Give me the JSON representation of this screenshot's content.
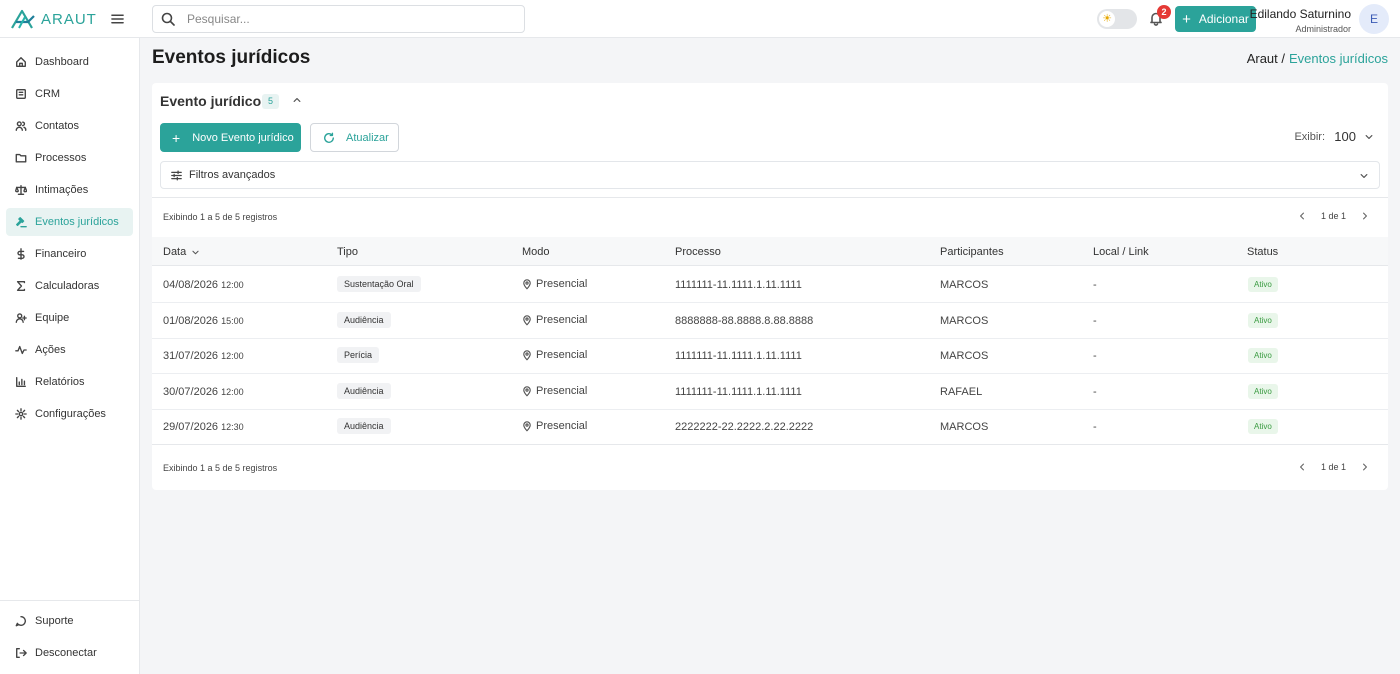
{
  "app": {
    "logo_text": "ARAUT"
  },
  "topbar": {
    "search_placeholder": "Pesquisar...",
    "notifications_count": "2",
    "add_label": "Adicionar",
    "user_name": "Edilando Saturnino",
    "user_role": "Administrador",
    "avatar_initial": "E"
  },
  "sidebar": {
    "items": [
      {
        "label": "Dashboard",
        "icon": "home-icon"
      },
      {
        "label": "CRM",
        "icon": "crm-icon"
      },
      {
        "label": "Contatos",
        "icon": "users-icon"
      },
      {
        "label": "Processos",
        "icon": "folder-icon"
      },
      {
        "label": "Intimações",
        "icon": "scale-icon"
      },
      {
        "label": "Eventos jurídicos",
        "icon": "gavel-icon"
      },
      {
        "label": "Financeiro",
        "icon": "dollar-icon"
      },
      {
        "label": "Calculadoras",
        "icon": "sigma-icon"
      },
      {
        "label": "Equipe",
        "icon": "user-plus-icon"
      },
      {
        "label": "Ações",
        "icon": "activity-icon"
      },
      {
        "label": "Relatórios",
        "icon": "bar-chart-icon"
      },
      {
        "label": "Configurações",
        "icon": "gear-icon"
      }
    ],
    "active": "Eventos jurídicos",
    "bottom": [
      {
        "label": "Suporte",
        "icon": "chat-icon"
      },
      {
        "label": "Desconectar",
        "icon": "logout-icon"
      }
    ]
  },
  "header": {
    "title": "Eventos jurídicos",
    "breadcrumb_root": "Araut /",
    "breadcrumb_current": "Eventos jurídicos"
  },
  "card": {
    "title": "Evento jurídico",
    "count": "5",
    "new_button": "Novo Evento jurídico",
    "refresh_button": "Atualizar",
    "exibir_label": "Exibir:",
    "exibir_value": "100",
    "filters_label": "Filtros avançados",
    "records_text": "Exibindo 1 a 5 de 5 registros",
    "page_text": "1 de 1"
  },
  "table": {
    "columns": [
      "Data",
      "Tipo",
      "Modo",
      "Processo",
      "Participantes",
      "Local / Link",
      "Status"
    ],
    "rows": [
      {
        "date": "04/08/2026",
        "time": "12:00",
        "tipo": "Sustentação Oral",
        "modo": "Presencial",
        "processo": "1111111-11.1111.1.11.1111",
        "participantes": "MARCOS",
        "local": "-",
        "status": "Ativo"
      },
      {
        "date": "01/08/2026",
        "time": "15:00",
        "tipo": "Audiência",
        "modo": "Presencial",
        "processo": "8888888-88.8888.8.88.8888",
        "participantes": "MARCOS",
        "local": "-",
        "status": "Ativo"
      },
      {
        "date": "31/07/2026",
        "time": "12:00",
        "tipo": "Perícia",
        "modo": "Presencial",
        "processo": "1111111-11.1111.1.11.1111",
        "participantes": "MARCOS",
        "local": "-",
        "status": "Ativo"
      },
      {
        "date": "30/07/2026",
        "time": "12:00",
        "tipo": "Audiência",
        "modo": "Presencial",
        "processo": "1111111-11.1111.1.11.1111",
        "participantes": "RAFAEL",
        "local": "-",
        "status": "Ativo"
      },
      {
        "date": "29/07/2026",
        "time": "12:30",
        "tipo": "Audiência",
        "modo": "Presencial",
        "processo": "2222222-22.2222.2.22.2222",
        "participantes": "MARCOS",
        "local": "-",
        "status": "Ativo"
      }
    ]
  },
  "colors": {
    "accent": "#2ba39a",
    "status_ok": "#3a9b41",
    "badge_red": "#e53935"
  }
}
